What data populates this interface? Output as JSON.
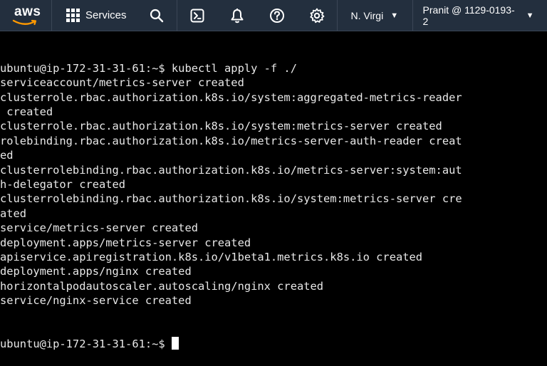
{
  "topbar": {
    "logo_text": "aws",
    "services_label": "Services",
    "icons": [
      "search-icon",
      "cloudshell-icon",
      "notifications-bell-icon",
      "help-icon",
      "settings-gear-icon"
    ],
    "region_label": "N. Virgi",
    "account_label": "Pranit @ 1129-0193-2",
    "colors": {
      "bar": "#232f3e",
      "logo_smile": "#ff9900"
    }
  },
  "terminal": {
    "lines": [
      "ubuntu@ip-172-31-31-61:~$ kubectl apply -f ./",
      "serviceaccount/metrics-server created",
      "clusterrole.rbac.authorization.k8s.io/system:aggregated-metrics-reader",
      " created",
      "clusterrole.rbac.authorization.k8s.io/system:metrics-server created",
      "rolebinding.rbac.authorization.k8s.io/metrics-server-auth-reader creat",
      "ed",
      "clusterrolebinding.rbac.authorization.k8s.io/metrics-server:system:aut",
      "h-delegator created",
      "clusterrolebinding.rbac.authorization.k8s.io/system:metrics-server cre",
      "ated",
      "service/metrics-server created",
      "deployment.apps/metrics-server created",
      "apiservice.apiregistration.k8s.io/v1beta1.metrics.k8s.io created",
      "deployment.apps/nginx created",
      "horizontalpodautoscaler.autoscaling/nginx created",
      "service/nginx-service created"
    ],
    "prompt": "ubuntu@ip-172-31-31-61:~$ ",
    "colors": {
      "background": "#000000",
      "text": "#e8e8e8"
    }
  }
}
